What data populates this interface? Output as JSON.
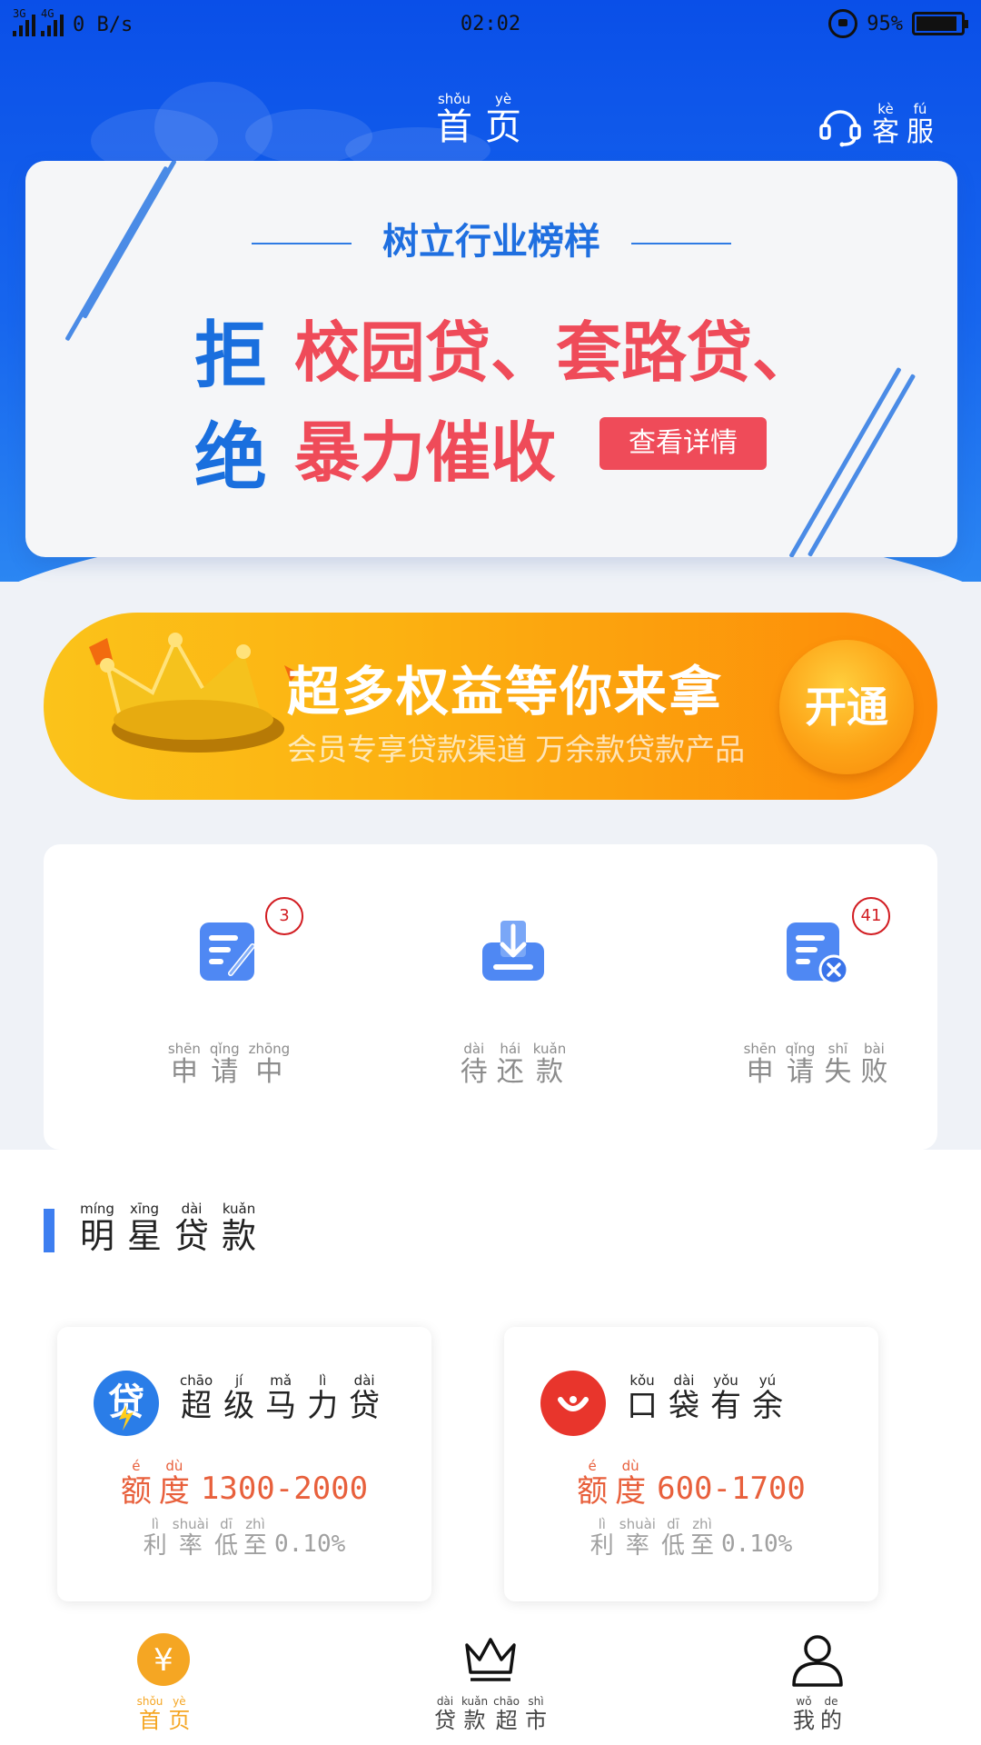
{
  "status_bar": {
    "network_1": "3G",
    "network_2": "4G",
    "speed": "0 B/s",
    "time": "02:02",
    "battery": "95%"
  },
  "header": {
    "title": [
      {
        "py": "shǒu",
        "hz": "首"
      },
      {
        "py": "yè",
        "hz": "页"
      }
    ],
    "service": [
      {
        "py": "kè",
        "hz": "客"
      },
      {
        "py": "fú",
        "hz": "服"
      }
    ]
  },
  "banner": {
    "subtitle": "树立行业榜样",
    "refuse_1": "拒",
    "refuse_2": "绝",
    "line1": "校园贷、套路贷、",
    "line2": "暴力催收",
    "button": "查看详情"
  },
  "vip": {
    "title": "超多权益等你来拿",
    "subtitle": "会员专享贷款渠道 万余款贷款产品",
    "button": "开通"
  },
  "loan_status": [
    {
      "label": [
        {
          "py": "shēn",
          "hz": "申"
        },
        {
          "py": "qǐng",
          "hz": "请"
        },
        {
          "py": "zhōng",
          "hz": "中"
        }
      ],
      "badge": "3",
      "icon": "edit-document-icon"
    },
    {
      "label": [
        {
          "py": "dài",
          "hz": "待"
        },
        {
          "py": "hái",
          "hz": "还"
        },
        {
          "py": "kuǎn",
          "hz": "款"
        }
      ],
      "badge": "",
      "icon": "download-tray-icon"
    },
    {
      "label": [
        {
          "py": "shēn",
          "hz": "申"
        },
        {
          "py": "qǐng",
          "hz": "请"
        },
        {
          "py": "shī",
          "hz": "失"
        },
        {
          "py": "bài",
          "hz": "败"
        }
      ],
      "badge": "41",
      "icon": "document-fail-icon"
    }
  ],
  "section": {
    "title": [
      {
        "py": "míng",
        "hz": "明"
      },
      {
        "py": "xīng",
        "hz": "星"
      },
      {
        "py": "dài",
        "hz": "贷"
      },
      {
        "py": "kuǎn",
        "hz": "款"
      }
    ]
  },
  "products": [
    {
      "name": [
        {
          "py": "chāo",
          "hz": "超"
        },
        {
          "py": "jí",
          "hz": "级"
        },
        {
          "py": "mǎ",
          "hz": "马"
        },
        {
          "py": "lì",
          "hz": "力"
        },
        {
          "py": "dài",
          "hz": "贷"
        }
      ],
      "limit_label": [
        {
          "py": "é",
          "hz": "额"
        },
        {
          "py": "dù",
          "hz": "度"
        }
      ],
      "limit": "1300-2000",
      "rate_label": [
        {
          "py": "lì",
          "hz": "利"
        },
        {
          "py": "shuài",
          "hz": "率"
        },
        {
          "py": "dī",
          "hz": "低"
        },
        {
          "py": "zhì",
          "hz": "至"
        }
      ],
      "rate": "0.10%",
      "logo_color": "#2a7de8"
    },
    {
      "name": [
        {
          "py": "kǒu",
          "hz": "口"
        },
        {
          "py": "dài",
          "hz": "袋"
        },
        {
          "py": "yǒu",
          "hz": "有"
        },
        {
          "py": "yú",
          "hz": "余"
        }
      ],
      "limit_label": [
        {
          "py": "é",
          "hz": "额"
        },
        {
          "py": "dù",
          "hz": "度"
        }
      ],
      "limit": "600-1700",
      "rate_label": [
        {
          "py": "lì",
          "hz": "利"
        },
        {
          "py": "shuài",
          "hz": "率"
        },
        {
          "py": "dī",
          "hz": "低"
        },
        {
          "py": "zhì",
          "hz": "至"
        }
      ],
      "rate": "0.10%",
      "logo_color": "#e8352c"
    }
  ],
  "tabs": [
    {
      "label": [
        {
          "py": "shǒu",
          "hz": "首"
        },
        {
          "py": "yè",
          "hz": "页"
        }
      ],
      "active": true,
      "icon": "yuan-coin-icon"
    },
    {
      "label": [
        {
          "py": "dài",
          "hz": "贷"
        },
        {
          "py": "kuǎn",
          "hz": "款"
        },
        {
          "py": "chāo",
          "hz": "超"
        },
        {
          "py": "shì",
          "hz": "市"
        }
      ],
      "active": false,
      "icon": "crown-icon"
    },
    {
      "label": [
        {
          "py": "wǒ",
          "hz": "我"
        },
        {
          "py": "de",
          "hz": "的"
        }
      ],
      "active": false,
      "icon": "user-icon"
    }
  ],
  "colors": {
    "header_blue": "#1766ee",
    "banner_red": "#ef4b59",
    "banner_blue": "#1a6fde",
    "vip_orange": "#fd8a08",
    "active_tab": "#f5a623",
    "badge_red": "#d21d22",
    "limit_orange": "#e8603c"
  },
  "currency_symbol": "¥"
}
